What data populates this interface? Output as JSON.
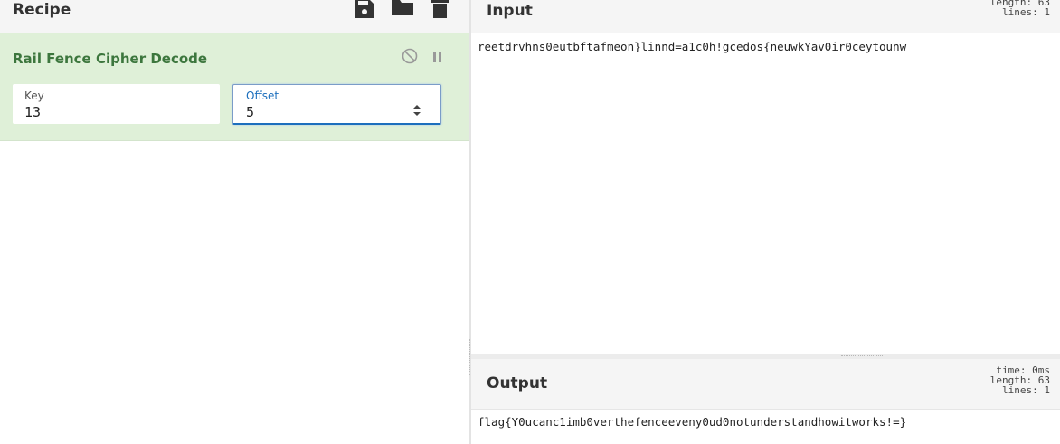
{
  "recipe": {
    "title": "Recipe",
    "icons": [
      "save-icon",
      "folder-icon",
      "trash-icon"
    ],
    "operation": {
      "title": "Rail Fence Cipher Decode",
      "icons": [
        "disable-icon",
        "pause-icon"
      ],
      "args": {
        "key_label": "Key",
        "key_value": "13",
        "offset_label": "Offset",
        "offset_value": "5"
      }
    }
  },
  "input": {
    "title": "Input",
    "stats_line1": "length: 63",
    "stats_line2": "lines:  1",
    "text": "reetdrvhns0eutbftafmeon}linnd=a1c0h!gcedos{neuwkYav0ir0ceytounw"
  },
  "output": {
    "title": "Output",
    "stats_line1": "time:  0ms",
    "stats_line2": "length:  63",
    "stats_line3": "lines:   1",
    "text": "flag{Y0ucanc1imb0verthefenceeveny0ud0notunderstandhowitworks!=}"
  },
  "colors": {
    "operation_bg": "#dff0d8",
    "operation_title": "#3c763d",
    "focus_blue": "#1c6fbd"
  }
}
